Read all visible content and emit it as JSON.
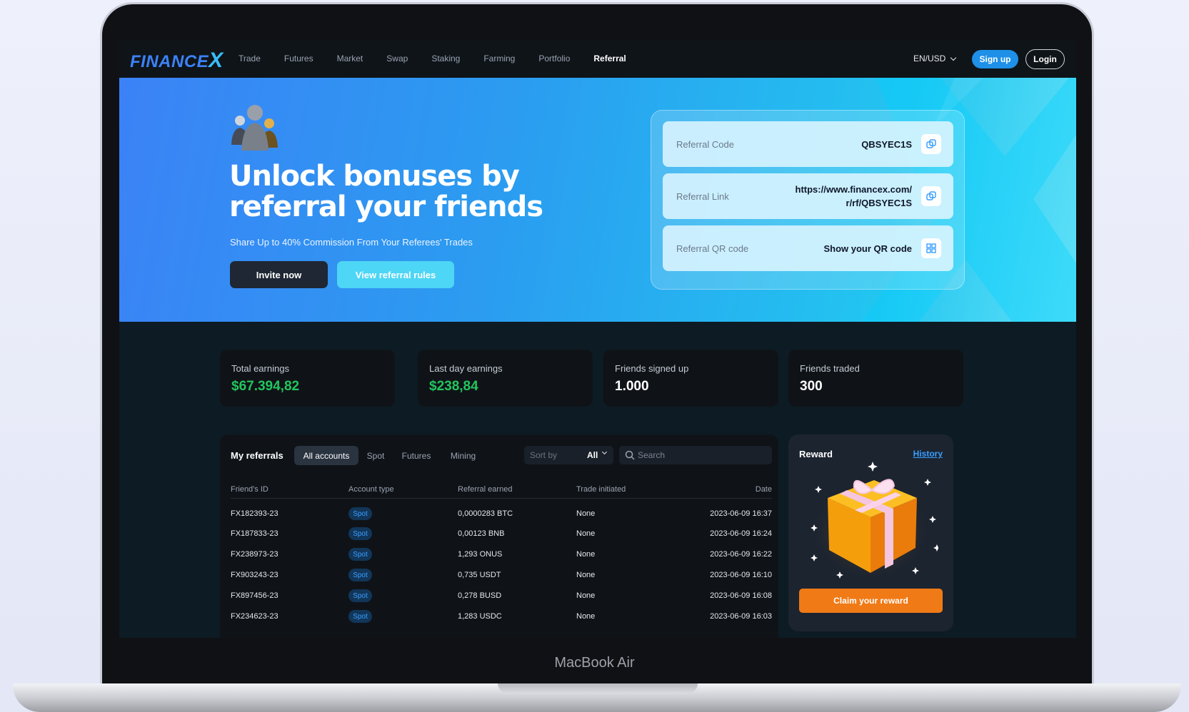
{
  "device": {
    "label": "MacBook Air"
  },
  "nav": {
    "logo": "FINANCEX",
    "links": [
      "Trade",
      "Futures",
      "Market",
      "Swap",
      "Staking",
      "Farming",
      "Portfolio",
      "Referral"
    ],
    "active": "Referral",
    "language": "EN/USD",
    "signup_label": "Sign up",
    "login_label": "Login"
  },
  "hero": {
    "title": "Unlock bonuses by referral your friends",
    "subtitle": "Share Up to 40% Commission From Your Referees' Trades",
    "invite_label": "Invite now",
    "rules_label": "View referral rules",
    "referral": {
      "code_label": "Referral Code",
      "code_value": "QBSYEC1S",
      "link_label": "Referral Link",
      "link_value_line1": "https://www.financex.com/",
      "link_value_line2": "r/rf/QBSYEC1S",
      "qr_label": "Referral QR code",
      "qr_value": "Show your QR code"
    }
  },
  "stats": [
    {
      "label": "Total earnings",
      "value": "$67.394,82"
    },
    {
      "label": "Last day earnings",
      "value": "$238,84"
    },
    {
      "label": "Friends signed up",
      "value": "1.000"
    },
    {
      "label": "Friends traded",
      "value": "300"
    }
  ],
  "referrals": {
    "title": "My referrals",
    "tabs": [
      "All accounts",
      "Spot",
      "Futures",
      "Mining"
    ],
    "sort_label": "Sort by",
    "sort_value": "All",
    "search_placeholder": "Search",
    "columns": [
      "Friend's ID",
      "Account type",
      "Referral earned",
      "Trade initiated",
      "Date"
    ],
    "rows": [
      {
        "id": "FX182393-23",
        "type": "Spot",
        "earned": "0,0000283 BTC",
        "trade": "None",
        "date": "2023-06-09 16:37"
      },
      {
        "id": "FX187833-23",
        "type": "Spot",
        "earned": "0,00123 BNB",
        "trade": "None",
        "date": "2023-06-09 16:24"
      },
      {
        "id": "FX238973-23",
        "type": "Spot",
        "earned": "1,293 ONUS",
        "trade": "None",
        "date": "2023-06-09 16:22"
      },
      {
        "id": "FX903243-23",
        "type": "Spot",
        "earned": "0,735 USDT",
        "trade": "None",
        "date": "2023-06-09 16:10"
      },
      {
        "id": "FX897456-23",
        "type": "Spot",
        "earned": "0,278 BUSD",
        "trade": "None",
        "date": "2023-06-09 16:08"
      },
      {
        "id": "FX234623-23",
        "type": "Spot",
        "earned": "1,283 USDC",
        "trade": "None",
        "date": "2023-06-09 16:03"
      }
    ]
  },
  "reward": {
    "title": "Reward",
    "history_label": "History",
    "claim_label": "Claim your reward"
  },
  "colors": {
    "accent_blue": "#1e90e8",
    "earnings_green": "#22c55e",
    "claim_orange": "#f07a16"
  }
}
